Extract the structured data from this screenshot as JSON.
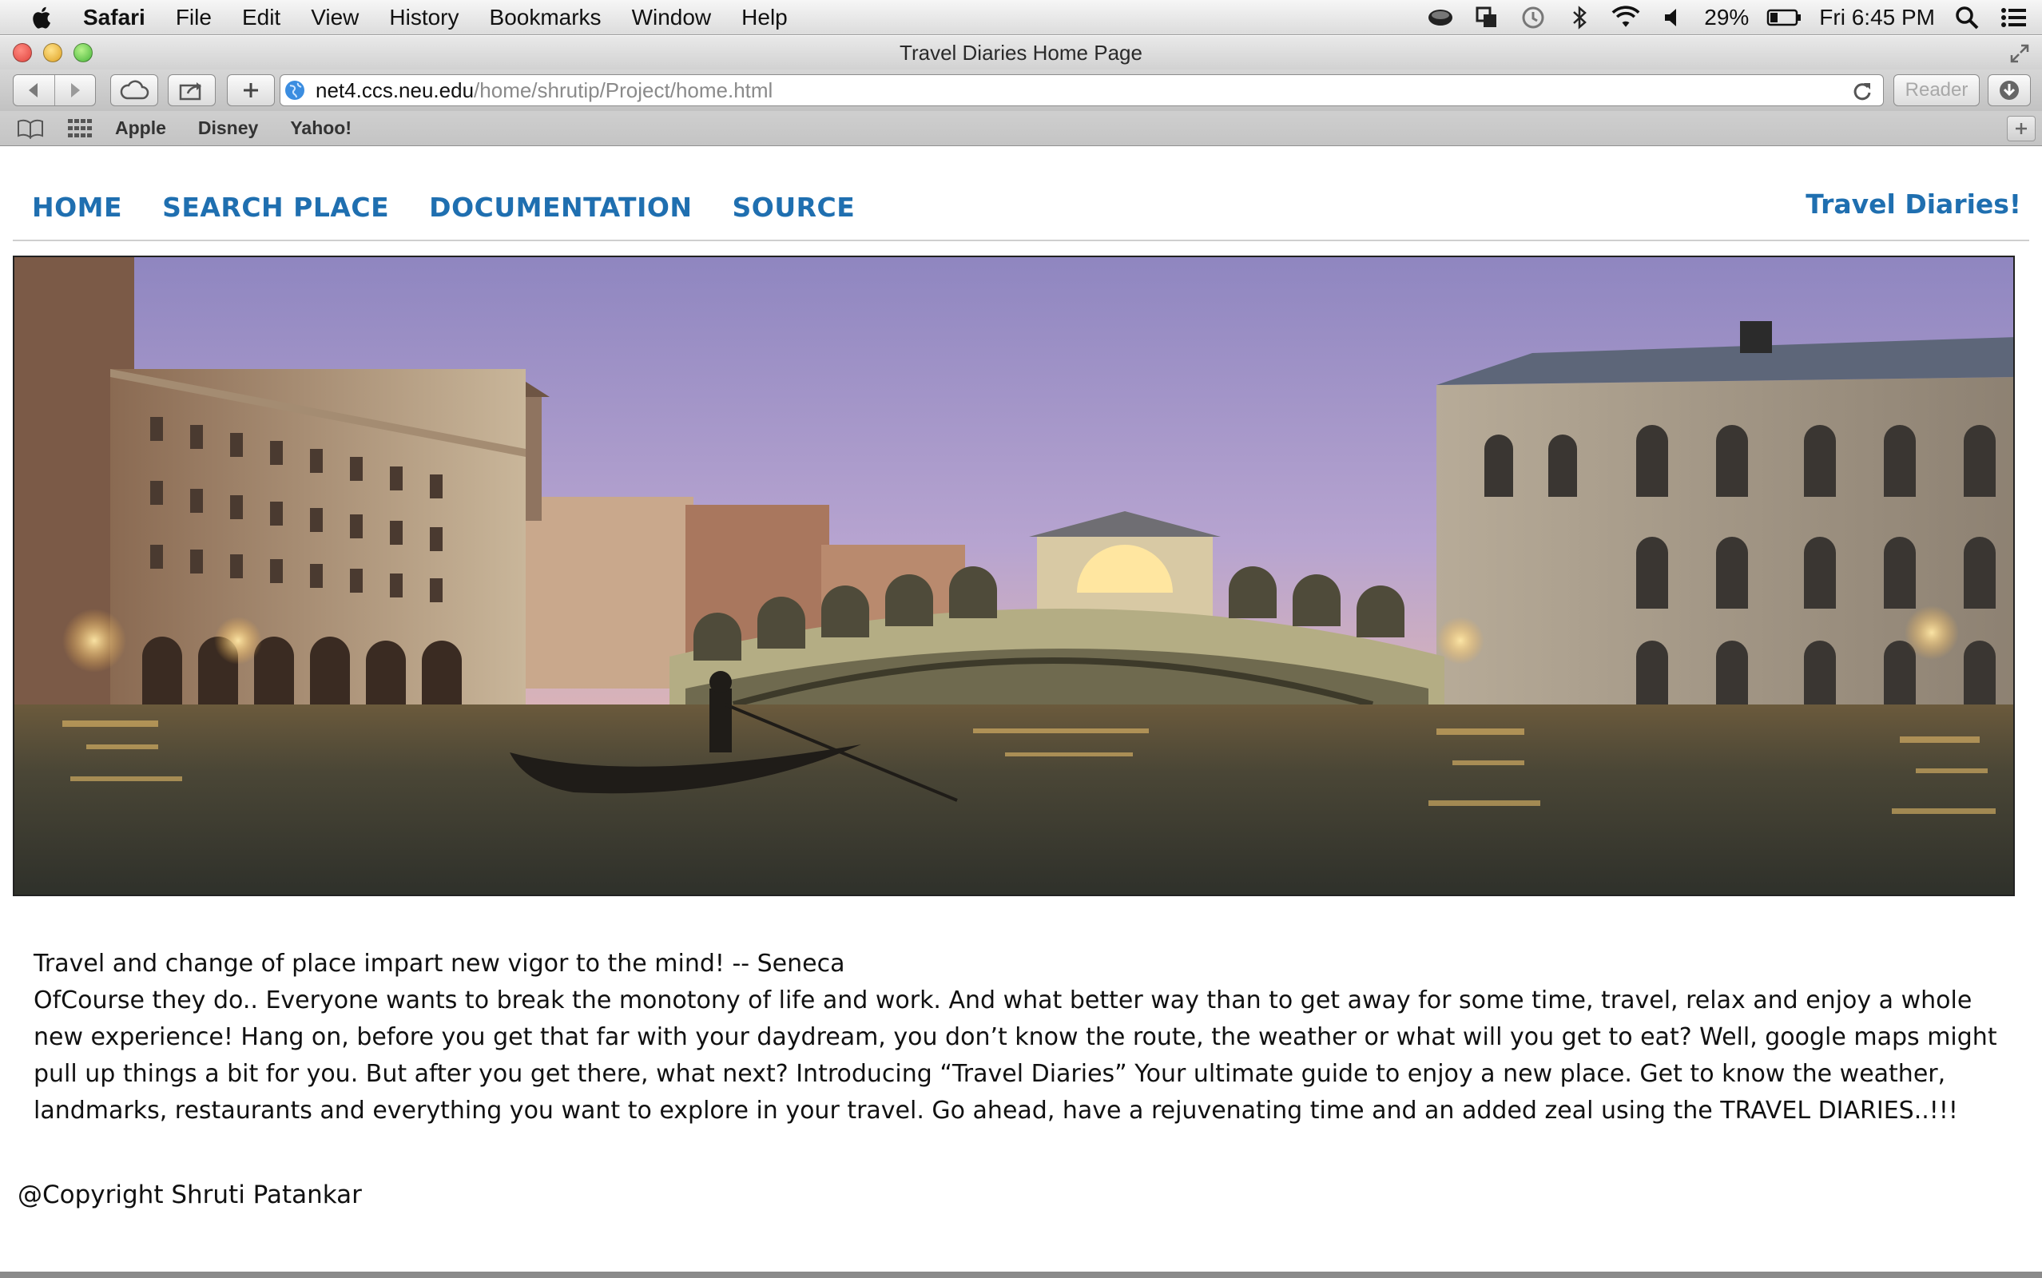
{
  "menubar": {
    "app": "Safari",
    "items": [
      "File",
      "Edit",
      "View",
      "History",
      "Bookmarks",
      "Window",
      "Help"
    ],
    "battery": "29%",
    "clock": "Fri 6:45 PM"
  },
  "window": {
    "title": "Travel Diaries Home Page"
  },
  "toolbar": {
    "url_host": "net4.ccs.neu.edu",
    "url_path": "/home/shrutip/Project/home.html",
    "reader_label": "Reader"
  },
  "bookmarks": [
    "Apple",
    "Disney",
    "Yahoo!"
  ],
  "site": {
    "nav": [
      "HOME",
      "SEARCH PLACE",
      "DOCUMENTATION",
      "SOURCE"
    ],
    "brand": "Travel Diaries!",
    "quote": "Travel and change of place impart new vigor to the mind! -- Seneca",
    "body": "OfCourse they do.. Everyone wants to break the monotony of life and work. And what better way than to get away for some time, travel, relax and enjoy a whole new experience! Hang on, before you get that far with your daydream, you don’t know the route, the weather or what will you get to eat? Well, google maps might pull up things a bit for you. But after you get there, what next? Introducing “Travel Diaries” Your ultimate guide to enjoy a new place. Get to know the weather, landmarks, restaurants and everything you want to explore in your travel. Go ahead, have a rejuvenating time and an added zeal using the TRAVEL DIARIES..!!!",
    "footer": "@Copyright Shruti Patankar"
  },
  "colors": {
    "nav_link": "#1f6fb0",
    "sky_top": "#8f86c0",
    "sky_bottom": "#e9b48f",
    "water": "#3e3a32"
  }
}
